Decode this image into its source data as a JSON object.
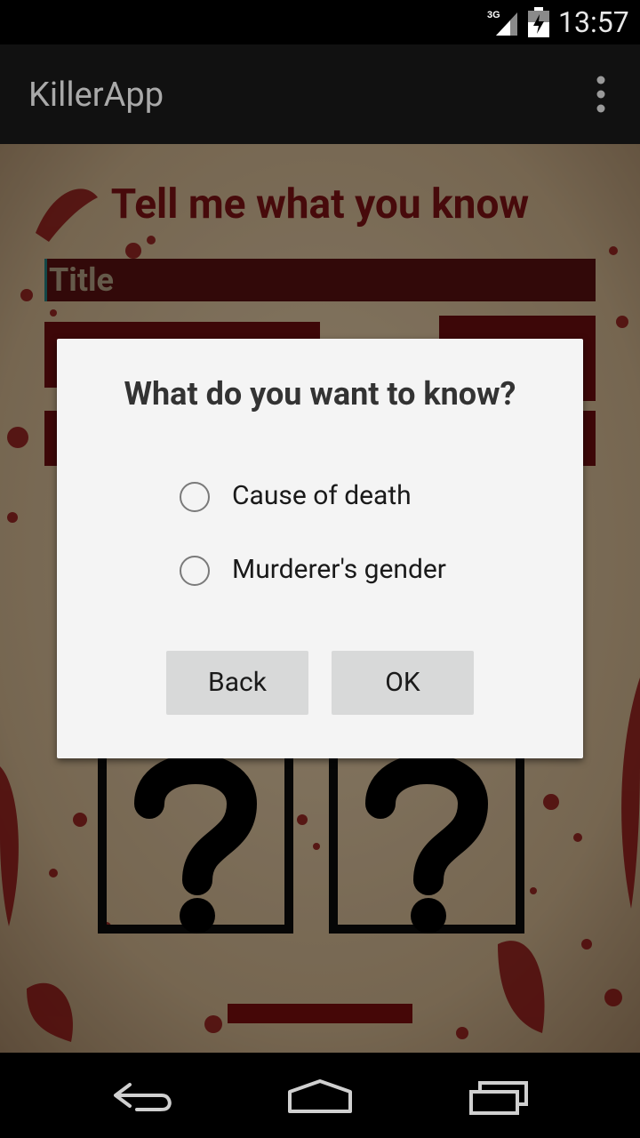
{
  "status_bar": {
    "network": "3G",
    "time": "13:57"
  },
  "action_bar": {
    "title": "KillerApp",
    "overflow_icon": "overflow-menu-icon"
  },
  "screen": {
    "heading": "Tell me what you know",
    "title_field_hint": "Title",
    "question_icon": "question-mark-icon"
  },
  "dialog": {
    "title": "What do you want to know?",
    "options": [
      {
        "label": "Cause of death",
        "checked": false
      },
      {
        "label": "Murderer's gender",
        "checked": false
      }
    ],
    "buttons": {
      "back": "Back",
      "ok": "OK"
    }
  },
  "nav_bar": {
    "icons": [
      "back-icon",
      "home-icon",
      "recents-icon"
    ]
  },
  "colors": {
    "blood": "#6e1012",
    "parchment": "#bba485",
    "dialog_bg": "#f4f4f4",
    "button_bg": "#d8d9d9"
  }
}
